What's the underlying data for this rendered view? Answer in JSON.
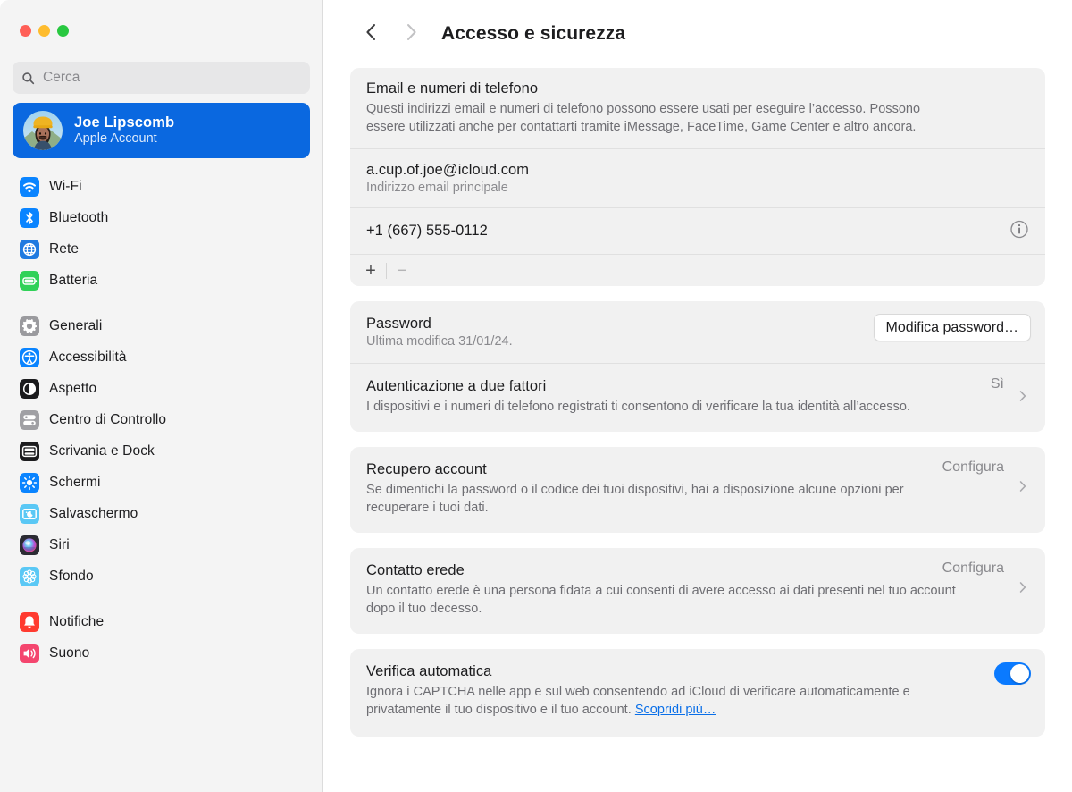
{
  "window": {
    "traffic_lights": [
      {
        "name": "close",
        "color": "#ff5f57"
      },
      {
        "name": "minimize",
        "color": "#febc2e"
      },
      {
        "name": "maximize",
        "color": "#28c840"
      }
    ]
  },
  "sidebar": {
    "search": {
      "value": "",
      "placeholder": "Cerca",
      "icon": "search-icon"
    },
    "account": {
      "name": "Joe Lipscomb",
      "subtitle": "Apple Account",
      "selected": true,
      "accent": "#0a68e0"
    },
    "groups": [
      {
        "items": [
          {
            "label": "Wi-Fi",
            "icon": "wifi-icon",
            "color": "#0a84ff"
          },
          {
            "label": "Bluetooth",
            "icon": "bluetooth-icon",
            "color": "#0a84ff"
          },
          {
            "label": "Rete",
            "icon": "network-icon",
            "color": "#1f7ae0"
          },
          {
            "label": "Batteria",
            "icon": "battery-icon",
            "color": "#30d158"
          }
        ]
      },
      {
        "items": [
          {
            "label": "Generali",
            "icon": "gear-icon",
            "color": "#9a9a9e"
          },
          {
            "label": "Accessibilità",
            "icon": "accessibility-icon",
            "color": "#0a84ff"
          },
          {
            "label": "Aspetto",
            "icon": "appearance-icon",
            "color": "#1c1c1e"
          },
          {
            "label": "Centro di Controllo",
            "icon": "control-center-icon",
            "color": "#a0a0a4"
          },
          {
            "label": "Scrivania e Dock",
            "icon": "desktop-dock-icon",
            "color": "#1c1c1e"
          },
          {
            "label": "Schermi",
            "icon": "displays-icon",
            "color": "#0a84ff"
          },
          {
            "label": "Salvaschermo",
            "icon": "screensaver-icon",
            "color": "#5ac8f5"
          },
          {
            "label": "Siri",
            "icon": "siri-icon",
            "color": "#2b2b33"
          },
          {
            "label": "Sfondo",
            "icon": "wallpaper-icon",
            "color": "#5ac8f5"
          }
        ]
      },
      {
        "items": [
          {
            "label": "Notifiche",
            "icon": "notifications-icon",
            "color": "#ff3b30"
          },
          {
            "label": "Suono",
            "icon": "sound-icon",
            "color": "#f4466e"
          }
        ]
      }
    ]
  },
  "main": {
    "back_icon": "chevron-left-icon",
    "forward_icon": "chevron-right-icon",
    "title": "Accesso e sicurezza",
    "cards": {
      "contacts": {
        "title": "Email e numeri di telefono",
        "description": "Questi indirizzi email e numeri di telefono possono essere usati per eseguire l’accesso. Possono essere utilizzati anche per contattarti tramite iMessage, FaceTime, Game Center e altro ancora.",
        "email": "a.cup.of.joe@icloud.com",
        "email_sub": "Indirizzo email principale",
        "phone": "+1 (667) 555-0112",
        "phone_info_icon": "info-icon",
        "add_label": "+",
        "remove_label": "−"
      },
      "password": {
        "title": "Password",
        "subtitle": "Ultima modifica 31/01/24.",
        "button_label": "Modifica password…"
      },
      "two_factor": {
        "title": "Autenticazione a due fattori",
        "description": "I dispositivi e i numeri di telefono registrati ti consentono di verificare la tua identità all’accesso.",
        "value": "Sì"
      },
      "account_recovery": {
        "title": "Recupero account",
        "description": "Se dimentichi la password o il codice dei tuoi dispositivi, hai a disposizione alcune opzioni per recuperare i tuoi dati.",
        "value": "Configura"
      },
      "legacy_contact": {
        "title": "Contatto erede",
        "description": "Un contatto erede è una persona fidata a cui consenti di avere accesso ai dati presenti nel tuo account dopo il tuo decesso.",
        "value": "Configura"
      },
      "auto_verify": {
        "title": "Verifica automatica",
        "description": "Ignora i CAPTCHA nelle app e sul web consentendo ad iCloud di verificare automaticamente e privatamente il tuo dispositivo e il tuo account. ",
        "link_label": "Scopridi più…",
        "toggle_on": true,
        "toggle_color": "#0a7aff"
      }
    }
  }
}
